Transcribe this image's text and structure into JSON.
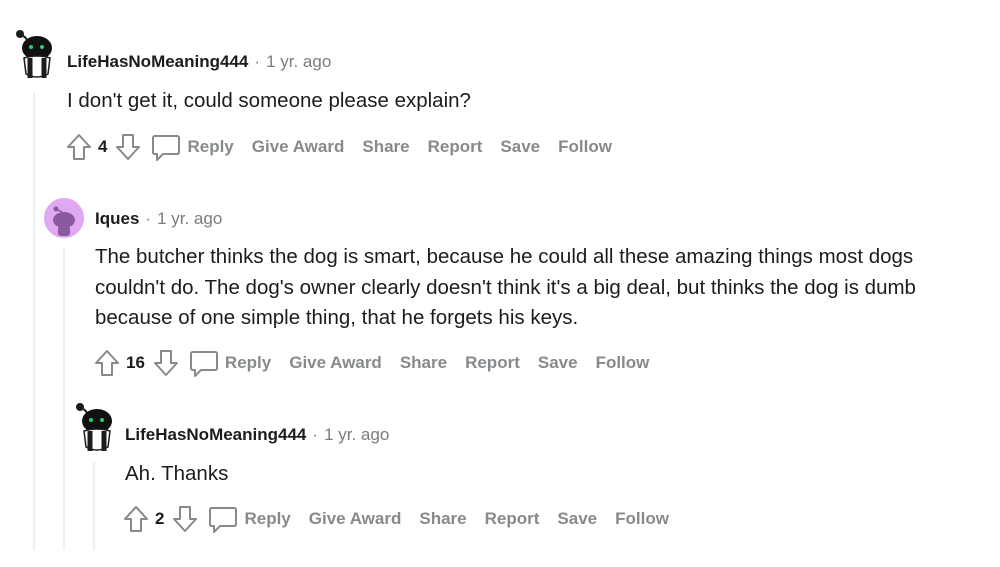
{
  "comments": [
    {
      "username": "LifeHasNoMeaning444",
      "separator": "·",
      "time": "1 yr. ago",
      "body": "I don't get it, could someone please explain?",
      "score": "4"
    },
    {
      "username": "Iques",
      "separator": "·",
      "time": "1 yr. ago",
      "body": "The butcher thinks the dog is smart, because he could all these amazing things most dogs couldn't do. The dog's owner clearly doesn't think it's a big deal, but thinks the dog is dumb because of one simple thing, that he forgets his keys.",
      "score": "16"
    },
    {
      "username": "LifeHasNoMeaning444",
      "separator": "·",
      "time": "1 yr. ago",
      "body": "Ah. Thanks",
      "score": "2"
    }
  ],
  "actions": {
    "reply": "Reply",
    "give_award": "Give Award",
    "share": "Share",
    "report": "Report",
    "save": "Save",
    "follow": "Follow"
  },
  "icons": {
    "upvote": "upvote-arrow-icon",
    "downvote": "downvote-arrow-icon",
    "reply": "speech-bubble-icon",
    "avatar_snoo_dark": "snoo-avatar-dark",
    "avatar_snoo_purple": "snoo-avatar-purple"
  },
  "colors": {
    "action_gray": "#878a8c",
    "thread_line": "#edeff1",
    "avatar_purple_bg": "#e0a8f0"
  }
}
